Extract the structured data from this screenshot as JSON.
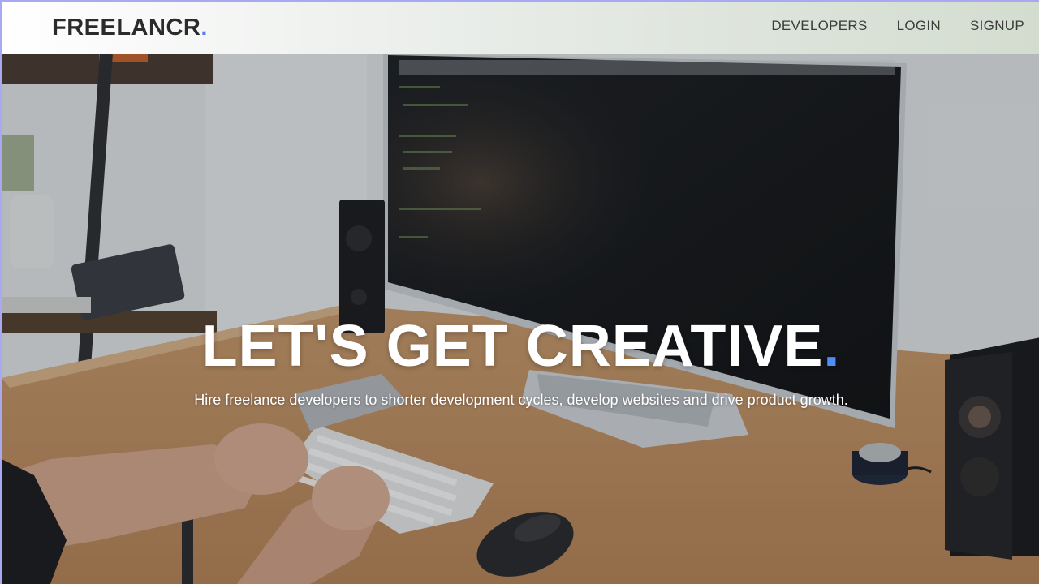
{
  "brand": {
    "name": "FREELANCR",
    "dot": ".",
    "dot_color": "#5b7cf0"
  },
  "nav": {
    "items": [
      {
        "label": "DEVELOPERS"
      },
      {
        "label": "LOGIN"
      },
      {
        "label": "SIGNUP"
      }
    ]
  },
  "hero": {
    "title": "LET'S GET CREATIVE",
    "title_dot": ".",
    "title_dot_color": "#4e8ef7",
    "subtitle": "Hire freelance developers to shorter development cycles, develop websites and drive product growth."
  },
  "colors": {
    "navbar_border": "#a9a8f3",
    "text_dark": "#2b2b2b"
  }
}
